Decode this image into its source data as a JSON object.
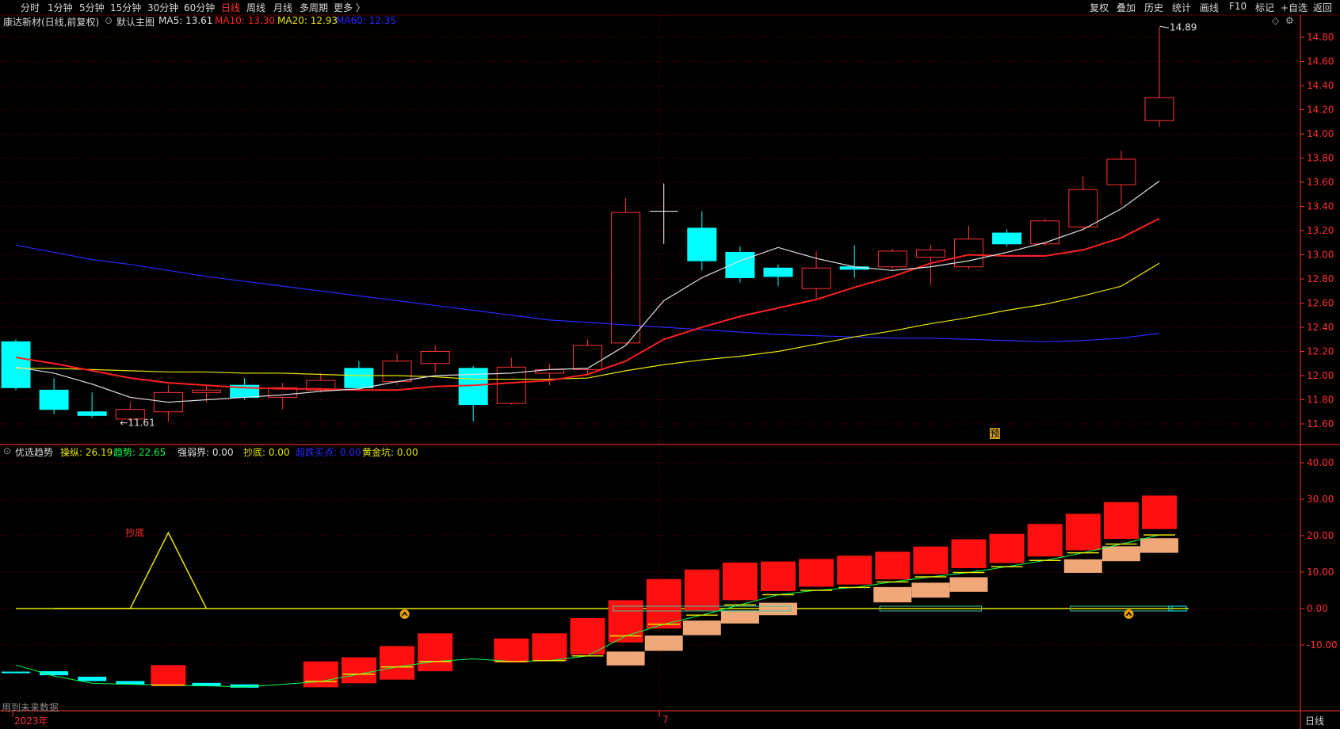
{
  "toolbar": {
    "periods": [
      {
        "label": "分时",
        "active": false
      },
      {
        "label": "1分钟",
        "active": false
      },
      {
        "label": "5分钟",
        "active": false
      },
      {
        "label": "15分钟",
        "active": false
      },
      {
        "label": "30分钟",
        "active": false
      },
      {
        "label": "60分钟",
        "active": false
      },
      {
        "label": "日线",
        "active": true
      },
      {
        "label": "周线",
        "active": false
      },
      {
        "label": "月线",
        "active": false
      },
      {
        "label": "多周期",
        "active": false
      },
      {
        "label": "更多 〉",
        "active": false
      }
    ],
    "actions": [
      "复权",
      "叠加",
      "历史",
      "统计",
      "画线",
      "F10",
      "标记",
      "+自选",
      "返回"
    ]
  },
  "main_header": {
    "stock": "康达新材(日线,前复权)",
    "chart_label": "默认主图",
    "ma5": "MA5: 13.61",
    "ma10": "MA10: 13.30",
    "ma20": "MA20: 12.93",
    "ma60": "MA60: 12.35"
  },
  "colors": {
    "up": "#ff3333",
    "down": "#00ffff",
    "ma5": "#e0e0e0",
    "ma10": "#ff2020",
    "ma20": "#e6e600",
    "ma60": "#2a2aff",
    "grid": "#7a0000",
    "axis": "#ff3030"
  },
  "indicator_header": {
    "name": "优选趋势",
    "cz": "操纵: 26.19",
    "qs": "趋势: 22.65",
    "qrj": "强弱界: 0.00",
    "cd": "抄底: 0.00",
    "dd": "超跌买点: 0.00",
    "hjk": "黄金坑: 0.00"
  },
  "chart_data": [
    {
      "type": "candlestick",
      "y_ticks": [
        "14.80",
        "14.60",
        "14.40",
        "14.20",
        "14.00",
        "13.80",
        "13.60",
        "13.40",
        "13.20",
        "13.00",
        "12.80",
        "12.60",
        "12.40",
        "12.20",
        "12.00",
        "11.80",
        "11.60"
      ],
      "ylim": [
        11.5,
        15.0
      ],
      "candles": [
        {
          "o": 12.28,
          "c": 11.9,
          "h": 12.3,
          "l": 11.88
        },
        {
          "o": 11.88,
          "c": 11.72,
          "h": 11.98,
          "l": 11.68
        },
        {
          "o": 11.7,
          "c": 11.67,
          "h": 11.86,
          "l": 11.65
        },
        {
          "o": 11.64,
          "c": 11.72,
          "h": 11.78,
          "l": 11.62
        },
        {
          "o": 11.7,
          "c": 11.86,
          "h": 11.92,
          "l": 11.62
        },
        {
          "o": 11.86,
          "c": 11.88,
          "h": 11.92,
          "l": 11.78
        },
        {
          "o": 11.92,
          "c": 11.82,
          "h": 11.98,
          "l": 11.8
        },
        {
          "o": 11.82,
          "c": 11.9,
          "h": 11.94,
          "l": 11.72
        },
        {
          "o": 11.88,
          "c": 11.96,
          "h": 12.02,
          "l": 11.86
        },
        {
          "o": 12.06,
          "c": 11.9,
          "h": 12.12,
          "l": 11.88
        },
        {
          "o": 11.95,
          "c": 12.12,
          "h": 12.18,
          "l": 11.92
        },
        {
          "o": 12.1,
          "c": 12.2,
          "h": 12.25,
          "l": 12.02
        },
        {
          "o": 12.06,
          "c": 11.76,
          "h": 12.08,
          "l": 11.62
        },
        {
          "o": 11.77,
          "c": 12.07,
          "h": 12.15,
          "l": 11.76
        },
        {
          "o": 12.02,
          "c": 12.05,
          "h": 12.1,
          "l": 11.92
        },
        {
          "o": 12.05,
          "c": 12.25,
          "h": 12.3,
          "l": 12.0
        },
        {
          "o": 12.27,
          "c": 13.35,
          "h": 13.47,
          "l": 12.26
        },
        {
          "o": 13.36,
          "c": 13.36,
          "h": 13.59,
          "l": 13.09
        },
        {
          "o": 13.22,
          "c": 12.95,
          "h": 13.36,
          "l": 12.87
        },
        {
          "o": 13.02,
          "c": 12.81,
          "h": 13.07,
          "l": 12.77
        },
        {
          "o": 12.89,
          "c": 12.82,
          "h": 12.92,
          "l": 12.74
        },
        {
          "o": 12.72,
          "c": 12.89,
          "h": 13.03,
          "l": 12.64
        },
        {
          "o": 12.9,
          "c": 12.88,
          "h": 13.08,
          "l": 12.81
        },
        {
          "o": 12.9,
          "c": 13.03,
          "h": 13.05,
          "l": 12.88
        },
        {
          "o": 12.98,
          "c": 13.04,
          "h": 13.08,
          "l": 12.75
        },
        {
          "o": 12.9,
          "c": 13.13,
          "h": 13.24,
          "l": 12.88
        },
        {
          "o": 13.18,
          "c": 13.09,
          "h": 13.21,
          "l": 13.07
        },
        {
          "o": 13.09,
          "c": 13.28,
          "h": 13.3,
          "l": 13.07
        },
        {
          "o": 13.23,
          "c": 13.54,
          "h": 13.65,
          "l": 13.21
        },
        {
          "o": 13.58,
          "c": 13.79,
          "h": 13.86,
          "l": 13.41
        },
        {
          "o": 14.11,
          "c": 14.3,
          "h": 14.89,
          "l": 14.06
        }
      ],
      "ma5": [
        12.07,
        12.02,
        11.93,
        11.82,
        11.78,
        11.8,
        11.82,
        11.84,
        11.87,
        11.89,
        11.95,
        12.0,
        12.01,
        12.02,
        12.05,
        12.06,
        12.25,
        12.62,
        12.81,
        12.95,
        13.06,
        12.97,
        12.9,
        12.87,
        12.9,
        12.95,
        13.02,
        13.1,
        13.21,
        13.38,
        13.61
      ],
      "ma10": [
        12.15,
        12.1,
        12.04,
        11.98,
        11.94,
        11.92,
        11.9,
        11.89,
        11.89,
        11.88,
        11.88,
        11.91,
        11.92,
        11.94,
        11.96,
        12.01,
        12.12,
        12.3,
        12.4,
        12.49,
        12.56,
        12.63,
        12.73,
        12.82,
        12.93,
        13.0,
        12.99,
        12.99,
        13.04,
        13.14,
        13.3
      ],
      "ma20": [
        12.06,
        12.06,
        12.05,
        12.04,
        12.03,
        12.03,
        12.02,
        12.02,
        12.01,
        12.0,
        12.0,
        11.99,
        11.97,
        11.97,
        11.97,
        11.98,
        12.04,
        12.09,
        12.13,
        12.16,
        12.2,
        12.26,
        12.32,
        12.37,
        12.43,
        12.48,
        12.54,
        12.59,
        12.66,
        12.74,
        12.93
      ],
      "ma60": [
        13.08,
        13.02,
        12.96,
        12.92,
        12.87,
        12.82,
        12.78,
        12.74,
        12.7,
        12.66,
        12.62,
        12.58,
        12.54,
        12.5,
        12.46,
        12.44,
        12.42,
        12.4,
        12.38,
        12.36,
        12.34,
        12.33,
        12.32,
        12.31,
        12.31,
        12.3,
        12.29,
        12.28,
        12.29,
        12.31,
        12.35
      ],
      "annotations": [
        "←11.61",
        "14.89",
        "预"
      ]
    },
    {
      "type": "bar",
      "series_name": "优选趋势",
      "y_ticks": [
        "40.00",
        "30.00",
        "20.00",
        "10.00",
        "0.00",
        "-10.00"
      ],
      "ylim": [
        -28,
        45
      ],
      "red_boxes": [
        {
          "i": 4,
          "top": -15.5,
          "bottom": -21.3
        },
        {
          "i": 8,
          "top": -14.5,
          "bottom": -21.6
        },
        {
          "i": 9,
          "top": -13.4,
          "bottom": -20.5
        },
        {
          "i": 10,
          "top": -10.3,
          "bottom": -19.5
        },
        {
          "i": 11,
          "top": -6.8,
          "bottom": -17.2
        },
        {
          "i": 13,
          "top": -8.2,
          "bottom": -14.8
        },
        {
          "i": 14,
          "top": -6.8,
          "bottom": -14.4
        },
        {
          "i": 15,
          "top": -2.6,
          "bottom": -12.6
        },
        {
          "i": 16,
          "top": 2.3,
          "bottom": -9.3
        },
        {
          "i": 17,
          "top": 8.1,
          "bottom": -5.5
        },
        {
          "i": 18,
          "top": 10.7,
          "bottom": -0.5
        },
        {
          "i": 19,
          "top": 12.6,
          "bottom": 2.3
        },
        {
          "i": 20,
          "top": 12.9,
          "bottom": 4.8
        },
        {
          "i": 21,
          "top": 13.6,
          "bottom": 6.0
        },
        {
          "i": 22,
          "top": 14.5,
          "bottom": 6.6
        },
        {
          "i": 23,
          "top": 15.6,
          "bottom": 8.0
        },
        {
          "i": 24,
          "top": 17.0,
          "bottom": 9.5
        },
        {
          "i": 25,
          "top": 19.0,
          "bottom": 11.1
        },
        {
          "i": 26,
          "top": 20.5,
          "bottom": 12.5
        },
        {
          "i": 27,
          "top": 23.2,
          "bottom": 14.3
        },
        {
          "i": 28,
          "top": 26.0,
          "bottom": 16.0
        },
        {
          "i": 29,
          "top": 29.2,
          "bottom": 19.1
        },
        {
          "i": 30,
          "top": 31.0,
          "bottom": 21.8
        }
      ],
      "cyan_bars": [
        {
          "i": 0,
          "top": -17.3,
          "bottom": -17.5
        },
        {
          "i": 1,
          "top": -17.2,
          "bottom": -18.3
        },
        {
          "i": 2,
          "top": -18.7,
          "bottom": -19.9
        },
        {
          "i": 3,
          "top": -19.9,
          "bottom": -20.8
        },
        {
          "i": 5,
          "top": -20.4,
          "bottom": -21.3
        },
        {
          "i": 6,
          "top": -20.8,
          "bottom": -21.7
        }
      ],
      "orange_boxes": [
        {
          "i": 16,
          "top": -11.8,
          "bottom": -15.6
        },
        {
          "i": 17,
          "top": -7.4,
          "bottom": -11.6
        },
        {
          "i": 18,
          "top": -3.3,
          "bottom": -7.3
        },
        {
          "i": 19,
          "top": -0.5,
          "bottom": -4.1
        },
        {
          "i": 20,
          "top": 1.6,
          "bottom": -1.8
        },
        {
          "i": 23,
          "top": 5.9,
          "bottom": 1.7
        },
        {
          "i": 24,
          "top": 7.1,
          "bottom": 3.0
        },
        {
          "i": 25,
          "top": 8.6,
          "bottom": 4.6
        },
        {
          "i": 28,
          "top": 13.5,
          "bottom": 9.8
        },
        {
          "i": 29,
          "top": 17.1,
          "bottom": 13.0
        },
        {
          "i": 30,
          "top": 19.3,
          "bottom": 15.3
        }
      ],
      "green_line": [
        -15.5,
        -18.5,
        -20.5,
        -20.8,
        -21.0,
        -21.2,
        -21.5,
        -20.8,
        -20.0,
        -18.0,
        -16.0,
        -14.5,
        -13.8,
        -14.5,
        -14.3,
        -13.0,
        -7.5,
        -4.3,
        -1.8,
        1.0,
        3.8,
        5.0,
        5.8,
        7.3,
        8.7,
        9.9,
        11.5,
        13.2,
        15.3,
        17.7,
        20.2
      ],
      "chaodi": {
        "label": "抄底",
        "values": [
          0,
          0,
          0,
          20.8,
          0
        ]
      },
      "markers": [
        10.2,
        29.2
      ],
      "zero_line": 0
    }
  ],
  "bottom": {
    "future_note": "用到未来数据",
    "year": "2023年",
    "month": "7",
    "period": "日线"
  }
}
